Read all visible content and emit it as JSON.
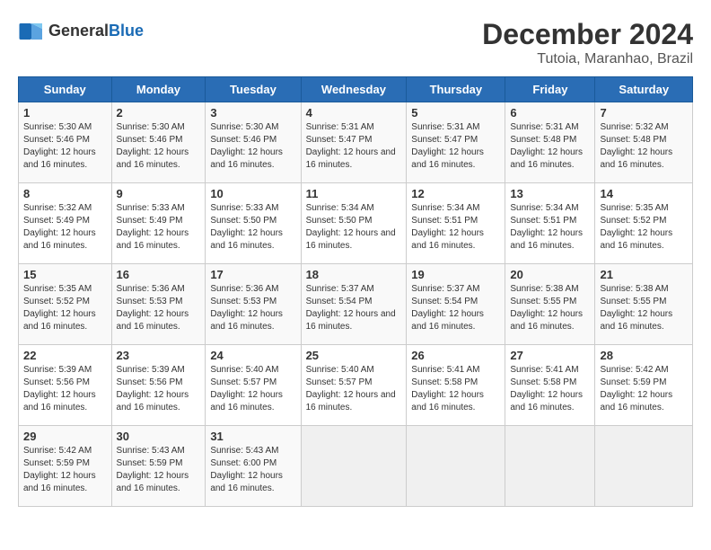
{
  "header": {
    "logo_general": "General",
    "logo_blue": "Blue",
    "month": "December 2024",
    "location": "Tutoia, Maranhao, Brazil"
  },
  "days_of_week": [
    "Sunday",
    "Monday",
    "Tuesday",
    "Wednesday",
    "Thursday",
    "Friday",
    "Saturday"
  ],
  "weeks": [
    [
      {
        "day": 1,
        "sunrise": "5:30 AM",
        "sunset": "5:46 PM",
        "daylight": "12 hours and 16 minutes."
      },
      {
        "day": 2,
        "sunrise": "5:30 AM",
        "sunset": "5:46 PM",
        "daylight": "12 hours and 16 minutes."
      },
      {
        "day": 3,
        "sunrise": "5:30 AM",
        "sunset": "5:46 PM",
        "daylight": "12 hours and 16 minutes."
      },
      {
        "day": 4,
        "sunrise": "5:31 AM",
        "sunset": "5:47 PM",
        "daylight": "12 hours and 16 minutes."
      },
      {
        "day": 5,
        "sunrise": "5:31 AM",
        "sunset": "5:47 PM",
        "daylight": "12 hours and 16 minutes."
      },
      {
        "day": 6,
        "sunrise": "5:31 AM",
        "sunset": "5:48 PM",
        "daylight": "12 hours and 16 minutes."
      },
      {
        "day": 7,
        "sunrise": "5:32 AM",
        "sunset": "5:48 PM",
        "daylight": "12 hours and 16 minutes."
      }
    ],
    [
      {
        "day": 8,
        "sunrise": "5:32 AM",
        "sunset": "5:49 PM",
        "daylight": "12 hours and 16 minutes."
      },
      {
        "day": 9,
        "sunrise": "5:33 AM",
        "sunset": "5:49 PM",
        "daylight": "12 hours and 16 minutes."
      },
      {
        "day": 10,
        "sunrise": "5:33 AM",
        "sunset": "5:50 PM",
        "daylight": "12 hours and 16 minutes."
      },
      {
        "day": 11,
        "sunrise": "5:34 AM",
        "sunset": "5:50 PM",
        "daylight": "12 hours and 16 minutes."
      },
      {
        "day": 12,
        "sunrise": "5:34 AM",
        "sunset": "5:51 PM",
        "daylight": "12 hours and 16 minutes."
      },
      {
        "day": 13,
        "sunrise": "5:34 AM",
        "sunset": "5:51 PM",
        "daylight": "12 hours and 16 minutes."
      },
      {
        "day": 14,
        "sunrise": "5:35 AM",
        "sunset": "5:52 PM",
        "daylight": "12 hours and 16 minutes."
      }
    ],
    [
      {
        "day": 15,
        "sunrise": "5:35 AM",
        "sunset": "5:52 PM",
        "daylight": "12 hours and 16 minutes."
      },
      {
        "day": 16,
        "sunrise": "5:36 AM",
        "sunset": "5:53 PM",
        "daylight": "12 hours and 16 minutes."
      },
      {
        "day": 17,
        "sunrise": "5:36 AM",
        "sunset": "5:53 PM",
        "daylight": "12 hours and 16 minutes."
      },
      {
        "day": 18,
        "sunrise": "5:37 AM",
        "sunset": "5:54 PM",
        "daylight": "12 hours and 16 minutes."
      },
      {
        "day": 19,
        "sunrise": "5:37 AM",
        "sunset": "5:54 PM",
        "daylight": "12 hours and 16 minutes."
      },
      {
        "day": 20,
        "sunrise": "5:38 AM",
        "sunset": "5:55 PM",
        "daylight": "12 hours and 16 minutes."
      },
      {
        "day": 21,
        "sunrise": "5:38 AM",
        "sunset": "5:55 PM",
        "daylight": "12 hours and 16 minutes."
      }
    ],
    [
      {
        "day": 22,
        "sunrise": "5:39 AM",
        "sunset": "5:56 PM",
        "daylight": "12 hours and 16 minutes."
      },
      {
        "day": 23,
        "sunrise": "5:39 AM",
        "sunset": "5:56 PM",
        "daylight": "12 hours and 16 minutes."
      },
      {
        "day": 24,
        "sunrise": "5:40 AM",
        "sunset": "5:57 PM",
        "daylight": "12 hours and 16 minutes."
      },
      {
        "day": 25,
        "sunrise": "5:40 AM",
        "sunset": "5:57 PM",
        "daylight": "12 hours and 16 minutes."
      },
      {
        "day": 26,
        "sunrise": "5:41 AM",
        "sunset": "5:58 PM",
        "daylight": "12 hours and 16 minutes."
      },
      {
        "day": 27,
        "sunrise": "5:41 AM",
        "sunset": "5:58 PM",
        "daylight": "12 hours and 16 minutes."
      },
      {
        "day": 28,
        "sunrise": "5:42 AM",
        "sunset": "5:59 PM",
        "daylight": "12 hours and 16 minutes."
      }
    ],
    [
      {
        "day": 29,
        "sunrise": "5:42 AM",
        "sunset": "5:59 PM",
        "daylight": "12 hours and 16 minutes."
      },
      {
        "day": 30,
        "sunrise": "5:43 AM",
        "sunset": "5:59 PM",
        "daylight": "12 hours and 16 minutes."
      },
      {
        "day": 31,
        "sunrise": "5:43 AM",
        "sunset": "6:00 PM",
        "daylight": "12 hours and 16 minutes."
      },
      null,
      null,
      null,
      null
    ]
  ]
}
